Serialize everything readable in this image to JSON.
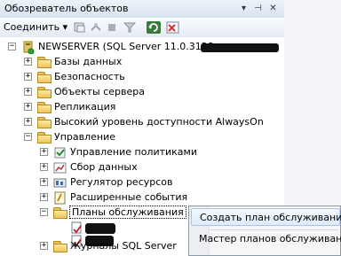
{
  "window": {
    "title": "Обозреватель объектов"
  },
  "toolbar": {
    "connect_label": "Соединить ▾"
  },
  "tree": {
    "server_label": "NEWSERVER (SQL Server 11.0.3128 - ",
    "items": [
      {
        "label": "Базы данных"
      },
      {
        "label": "Безопасность"
      },
      {
        "label": "Объекты сервера"
      },
      {
        "label": "Репликация"
      },
      {
        "label": "Высокий уровень доступности AlwaysOn"
      },
      {
        "label": "Управление"
      }
    ],
    "management": [
      {
        "label": "Управление политиками"
      },
      {
        "label": "Сбор данных"
      },
      {
        "label": "Регулятор ресурсов"
      },
      {
        "label": "Расширенные события"
      },
      {
        "label": "Планы обслуживания"
      },
      {
        "label": "Журналы SQL Server"
      }
    ]
  },
  "context_menu": {
    "items": [
      {
        "label": "Создать план обслуживания..."
      },
      {
        "label": "Мастер планов обслуживания"
      }
    ]
  }
}
